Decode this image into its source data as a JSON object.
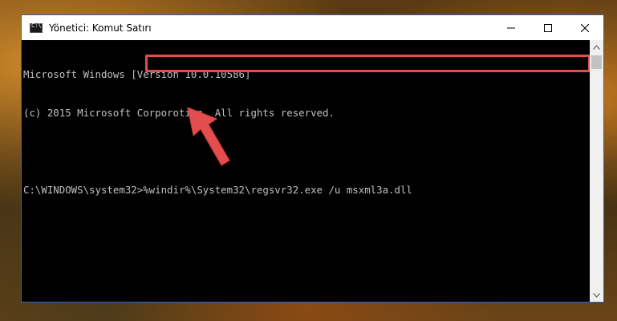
{
  "window": {
    "title": "Yönetici: Komut Satırı",
    "icon": "cmd-icon",
    "controls": {
      "minimize": "minimize-icon",
      "maximize": "maximize-icon",
      "close": "close-icon"
    }
  },
  "console": {
    "lines": [
      "Microsoft Windows [Version 10.0.10586]",
      "(c) 2015 Microsoft Corporotion. All rights reserved.",
      "",
      "C:\\WINDOWS\\system32>%windir%\\System32\\regsvr32.exe /u msxml3a.dll"
    ]
  },
  "annotation": {
    "highlight_color": "#e34d4d",
    "arrow_color": "#e34d4d",
    "arrow_icon": "pointer-arrow-icon"
  },
  "colors": {
    "console_bg": "#000000",
    "console_text": "#c0c0c0",
    "window_border": "#2b6cb8"
  }
}
